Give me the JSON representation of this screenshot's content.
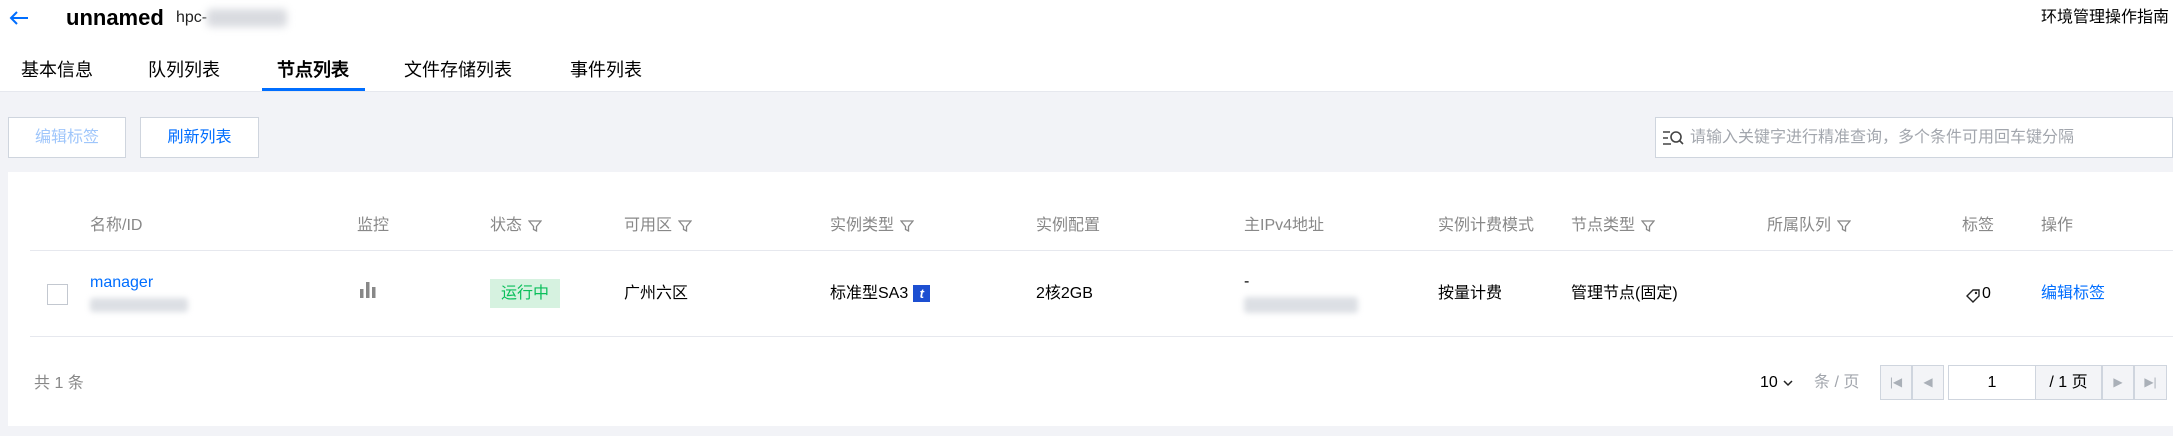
{
  "header": {
    "title": "unnamed",
    "subtitle": "hpc-",
    "guide_link": "环境管理操作指南"
  },
  "tabs": [
    {
      "label": "基本信息"
    },
    {
      "label": "队列列表"
    },
    {
      "label": "节点列表"
    },
    {
      "label": "文件存储列表"
    },
    {
      "label": "事件列表"
    }
  ],
  "active_tab": "节点列表",
  "toolbar": {
    "edit_tags_label": "编辑标签",
    "refresh_label": "刷新列表",
    "search_placeholder": "请输入关键字进行精准查询，多个条件可用回车键分隔"
  },
  "table": {
    "columns": [
      "名称/ID",
      "监控",
      "状态",
      "可用区",
      "实例类型",
      "实例配置",
      "主IPv4地址",
      "实例计费模式",
      "节点类型",
      "所属队列",
      "标签",
      "操作"
    ],
    "rows": [
      {
        "name": "manager",
        "status": "运行中",
        "zone": "广州六区",
        "instance_type": "标准型SA3",
        "instance_type_badge": "t",
        "config": "2核2GB",
        "ipv4": "-",
        "billing": "按量计费",
        "node_type": "管理节点(固定)",
        "queue": "",
        "tag_count": "0",
        "action": "编辑标签"
      }
    ]
  },
  "footer": {
    "total": "共 1 条",
    "page_size": "10",
    "page_size_unit": "条 / 页",
    "current_page": "1",
    "total_pages": "/ 1 页"
  },
  "colors": {
    "accent": "#006eff",
    "status_running_bg": "#d6f2e0",
    "status_running_text": "#0abf5b"
  }
}
